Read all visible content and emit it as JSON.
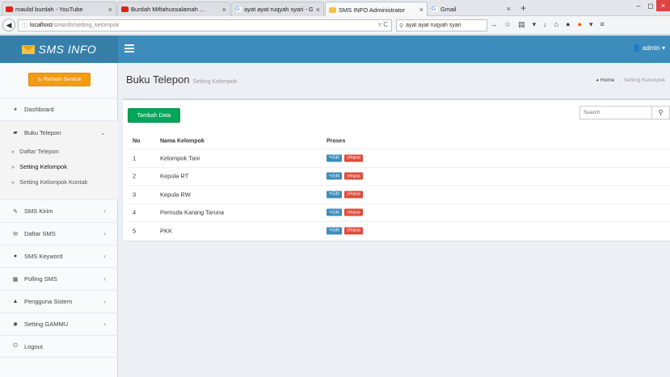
{
  "browser": {
    "tabs": [
      {
        "label": "maulid burdah - YouTube",
        "fav_color": "#e62117",
        "active": false
      },
      {
        "label": "Burdah Miftahussalamah ...",
        "fav_color": "#e62117",
        "active": false
      },
      {
        "label": "ayat ayat ruqyah syari - G...",
        "fav_color": "#4285f4",
        "active": false
      },
      {
        "label": "SMS INFO Administrator",
        "fav_color": "#f5c342",
        "active": true
      },
      {
        "label": "Gmail",
        "fav_color": "#4285f4",
        "active": false
      }
    ],
    "url_host": "localhost",
    "url_path": "/smsinfo/setting_kelompok",
    "search_value": "ayat ayat ruqyah syari"
  },
  "header": {
    "brand": "SMS INFO",
    "user": "admin"
  },
  "sidebar": {
    "refresh_label": "Refresh Service",
    "items": [
      {
        "label": "Dashboard",
        "icon": "dashboard-icon"
      },
      {
        "label": "Buku Telepon",
        "icon": "book-icon"
      },
      {
        "label": "SMS Kirim",
        "icon": "edit-icon"
      },
      {
        "label": "Daftar SMS",
        "icon": "envelope-icon"
      },
      {
        "label": "SMS Keyword",
        "icon": "comment-icon"
      },
      {
        "label": "Polling SMS",
        "icon": "chart-icon"
      },
      {
        "label": "Pengguna Sistem",
        "icon": "user-icon"
      },
      {
        "label": "Setting GAMMU",
        "icon": "gear-icon"
      },
      {
        "label": "Logout",
        "icon": "power-icon"
      }
    ],
    "subitems": [
      {
        "label": "Daftar Telepon"
      },
      {
        "label": "Setting Kelompok"
      },
      {
        "label": "Setting Kelompok Kontak"
      }
    ]
  },
  "page": {
    "title": "Buku Telepon",
    "subtitle": "Setting Kelompok",
    "breadcrumb_home": "Home",
    "breadcrumb_current": "Setting Kelompok"
  },
  "box": {
    "add_label": "Tambah Data",
    "search_placeholder": "Search",
    "columns": [
      "No",
      "Nama Kelompok",
      "Proses"
    ],
    "edit_label": "Edit",
    "delete_label": "Hapus",
    "rows": [
      {
        "no": "1",
        "name": "Kelompok Tani"
      },
      {
        "no": "2",
        "name": "Kepula RT"
      },
      {
        "no": "3",
        "name": "Kepula RW"
      },
      {
        "no": "4",
        "name": "Pemuda Karang Taruna"
      },
      {
        "no": "5",
        "name": "PKK"
      }
    ]
  }
}
